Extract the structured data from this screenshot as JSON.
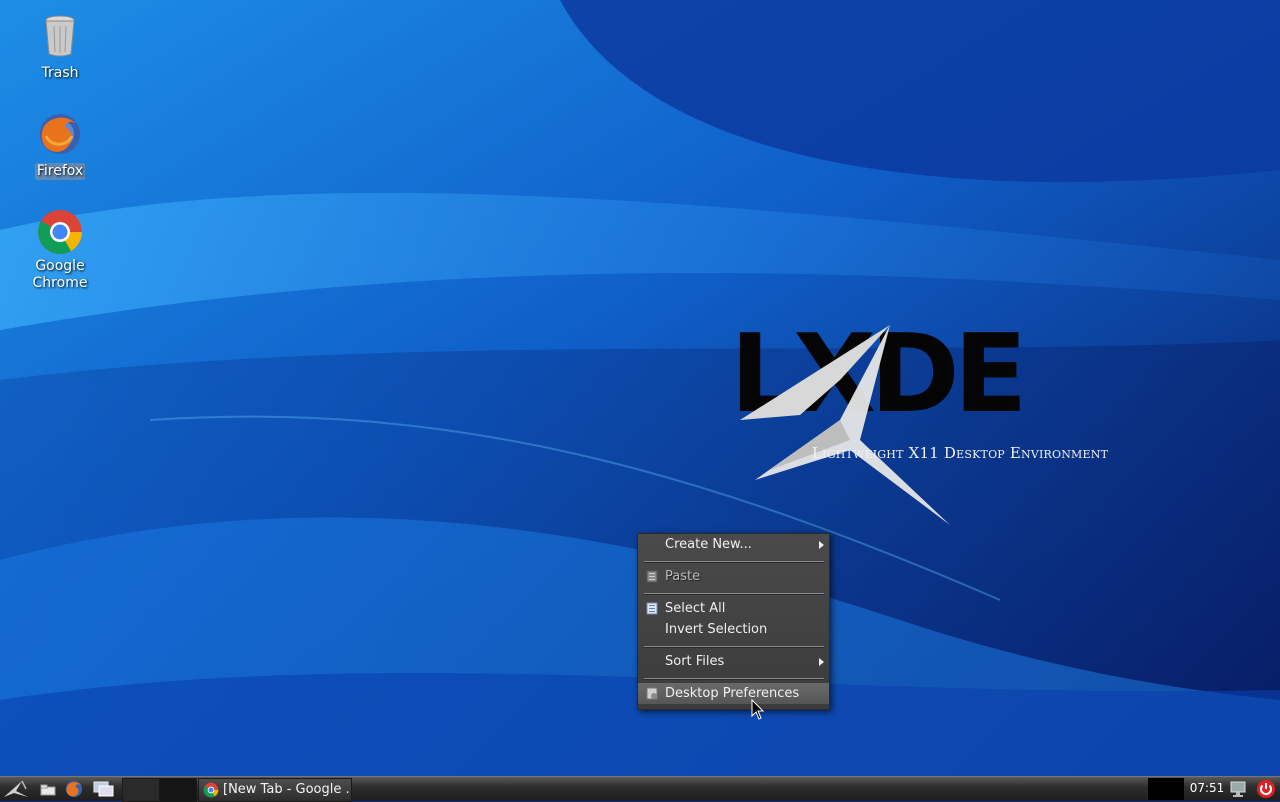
{
  "desktop": {
    "icons": [
      {
        "label": "Trash",
        "icon": "trash-icon",
        "selected": false
      },
      {
        "label": "Firefox",
        "icon": "firefox-icon",
        "selected": true
      },
      {
        "label_line1": "Google",
        "label_line2": "Chrome",
        "icon": "chrome-icon",
        "selected": false
      }
    ]
  },
  "wallpaper": {
    "logo_text": "LXDE",
    "subtitle": "Lightweight X11 Desktop Environment",
    "colors": {
      "base": "#0a2f8f",
      "light": "#2aa0f0",
      "dark": "#081a5a"
    }
  },
  "context_menu": {
    "items": [
      {
        "label": "Create New...",
        "has_submenu": true
      },
      {
        "label": "Paste",
        "disabled": true,
        "icon": "paste-icon"
      },
      {
        "label": "Select All",
        "icon": "select-all-icon"
      },
      {
        "label": "Invert Selection"
      },
      {
        "label": "Sort Files",
        "has_submenu": true
      },
      {
        "label": "Desktop Preferences",
        "icon": "preferences-icon",
        "hovered": true
      }
    ]
  },
  "taskbar": {
    "launchers": [
      "start-menu-icon",
      "file-manager-icon",
      "firefox-icon",
      "show-desktop-icon"
    ],
    "task": {
      "label": "[New Tab - Google ...",
      "icon": "chrome-icon"
    },
    "clock": "07:51",
    "tray": [
      "network-icon",
      "power-icon"
    ],
    "power_color": "#e02020"
  }
}
